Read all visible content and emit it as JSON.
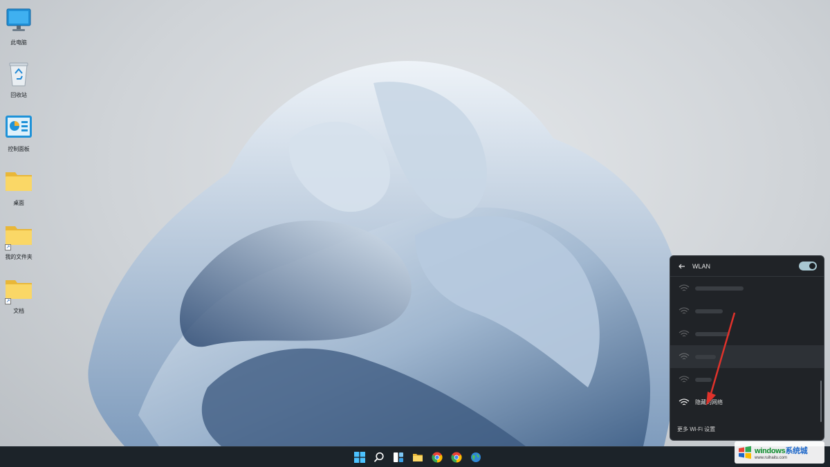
{
  "desktop": {
    "icons": [
      {
        "label": "此电脑",
        "icon": "computer-icon"
      },
      {
        "label": "回收站",
        "icon": "recycle-bin-icon"
      },
      {
        "label": "控制面板",
        "icon": "control-panel-icon"
      },
      {
        "label": "桌面",
        "icon": "folder-icon"
      },
      {
        "label": "我的文件夹",
        "icon": "folder-shortcut-icon"
      },
      {
        "label": "文档",
        "icon": "folder-shortcut-icon"
      }
    ]
  },
  "taskbar": {
    "apps": [
      {
        "name": "start-button",
        "icon": "windows-logo-icon"
      },
      {
        "name": "search-button",
        "icon": "search-icon"
      },
      {
        "name": "widgets-button",
        "icon": "widgets-icon"
      },
      {
        "name": "file-explorer-button",
        "icon": "folder-icon"
      },
      {
        "name": "chrome-button",
        "icon": "chrome-icon"
      },
      {
        "name": "chrome-button-2",
        "icon": "chrome-icon"
      },
      {
        "name": "browser-button",
        "icon": "globe-icon"
      }
    ]
  },
  "wlan": {
    "title": "WLAN",
    "toggle_on": true,
    "hidden_network_label": "隐藏的网络",
    "more_settings": "更多 Wi-Fi 设置"
  },
  "watermark": {
    "brand_green": "windows",
    "brand_blue": "系统城",
    "url": "www.ruihaitu.com"
  },
  "colors": {
    "taskbar": "#1c2329",
    "panel": "#202327",
    "accent_toggle": "#a8c7d1",
    "annotation": "#e0322b"
  }
}
